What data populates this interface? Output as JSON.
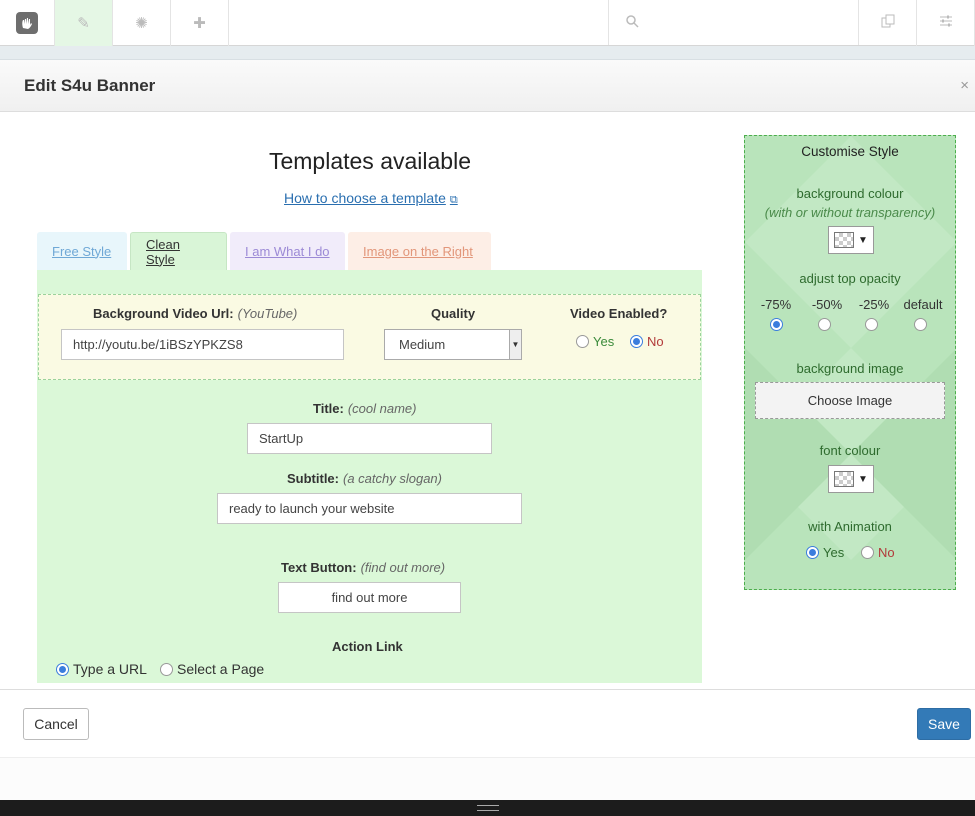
{
  "toolbar": {
    "icons": [
      "concrete5-logo-icon",
      "pencil-icon",
      "gear-icon",
      "plus-icon",
      "search-icon",
      "pages-icon",
      "sliders-icon"
    ]
  },
  "dialog": {
    "title": "Edit S4u Banner",
    "close": "×"
  },
  "main": {
    "title": "Templates available",
    "help_link": "How to choose a template",
    "tabs": [
      {
        "label": "Free Style"
      },
      {
        "label": "Clean Style",
        "active": true
      },
      {
        "label": "I am What I do"
      },
      {
        "label": "Image on the Right"
      }
    ]
  },
  "video": {
    "url_label": "Background Video Url:",
    "url_hint": "(YouTube)",
    "url_value": "http://youtu.be/1iBSzYPKZS8",
    "quality_label": "Quality",
    "quality_value": "Medium",
    "enabled_label": "Video Enabled?",
    "yes": "Yes",
    "no": "No",
    "enabled": "No"
  },
  "fields": {
    "title_label": "Title:",
    "title_hint": "(cool name)",
    "title_value": "StartUp",
    "subtitle_label": "Subtitle:",
    "subtitle_hint": "(a catchy slogan)",
    "subtitle_value": "ready to launch your website",
    "button_label": "Text Button:",
    "button_hint": "(find out more)",
    "button_value": "find out more",
    "action_label": "Action Link",
    "action_url": "Type a URL",
    "action_page": "Select a Page",
    "action_selected": "Type a URL"
  },
  "style": {
    "heading": "Customise Style",
    "bg_colour_label": "background colour",
    "bg_colour_hint": "(with or without transparency)",
    "opacity_label": "adjust top opacity",
    "opacity_options": [
      "-75%",
      "-50%",
      "-25%",
      "default"
    ],
    "opacity_selected": "-75%",
    "bg_image_label": "background image",
    "choose_image": "Choose Image",
    "font_colour_label": "font colour",
    "animation_label": "with Animation",
    "yes": "Yes",
    "no": "No",
    "animation": "Yes"
  },
  "footer": {
    "cancel": "Cancel",
    "save": "Save"
  },
  "colors": {
    "panel_green": "#dbf8d8",
    "side_green": "#b9e4bb",
    "save_blue": "#337ab7"
  }
}
